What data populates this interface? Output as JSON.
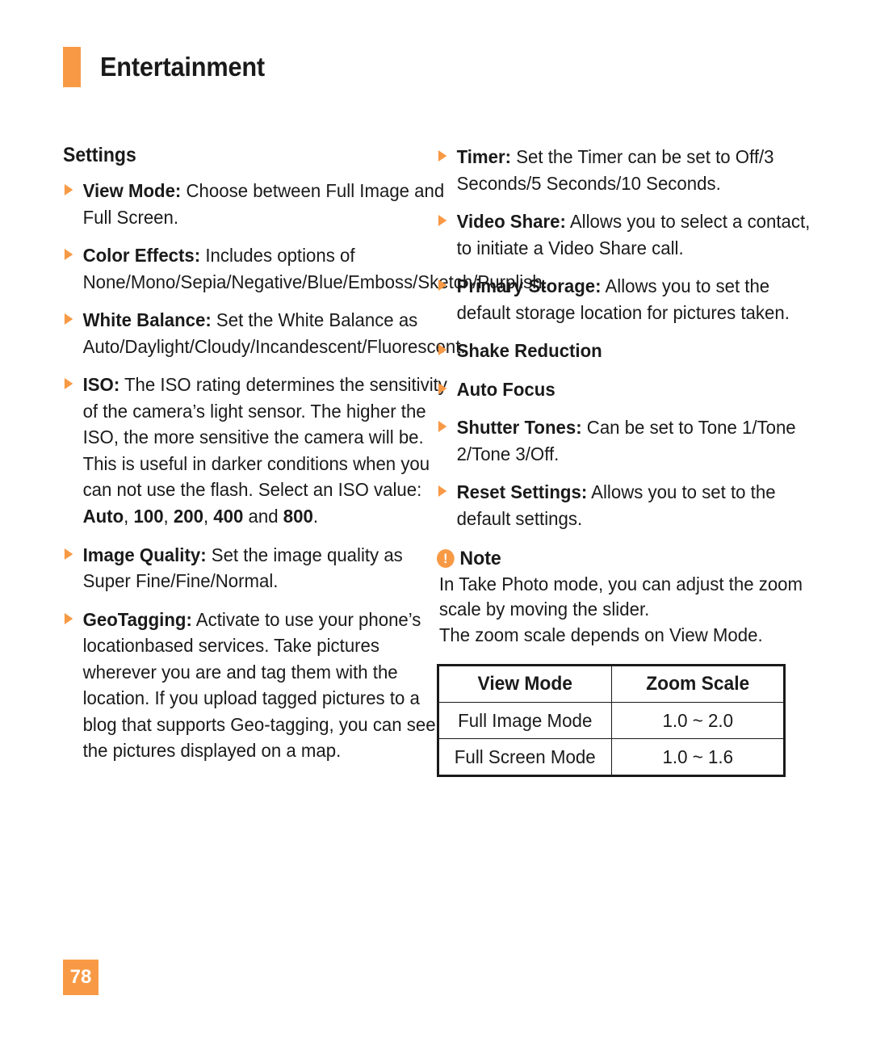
{
  "header": {
    "title": "Entertainment",
    "accent_color": "#F89A45"
  },
  "left_column": {
    "heading": "Settings",
    "items": [
      {
        "label": "View Mode:",
        "text": " Choose between Full Image and Full Screen."
      },
      {
        "label": "Color Effects:",
        "text": " Includes options of None/Mono/Sepia/Negative/Blue/Emboss/Sketch/Purplish."
      },
      {
        "label": "White Balance:",
        "text": " Set the White Balance as Auto/Daylight/Cloudy/Incandescent/Fluorescent."
      },
      {
        "label": "ISO:",
        "text_before": " The ISO rating determines the sensitivity of the camera’s light sensor. The higher the ISO, the more sensitive the camera will be. This is useful in darker conditions when you can not use the flash. Select an ISO value: ",
        "value_1": "Auto",
        "sep_1": ", ",
        "value_2": "100",
        "sep_2": ", ",
        "value_3": "200",
        "sep_3": ", ",
        "value_4": "400",
        "sep_4": " and ",
        "value_5": "800",
        "text_after": "."
      },
      {
        "label": "Image Quality:",
        "text": " Set the image quality as Super Fine/Fine/Normal."
      },
      {
        "label": "GeoTagging:",
        "text": " Activate to use your phone’s locationbased services. Take pictures wherever you are and tag them with the location. If you upload tagged pictures to a blog that supports Geo-tagging, you can see the pictures displayed on a map."
      }
    ]
  },
  "right_column": {
    "items": [
      {
        "label": "Timer:",
        "text": " Set the Timer can be set to Off/3 Seconds/5 Seconds/10 Seconds."
      },
      {
        "label": "Video Share:",
        "text": " Allows you to select a contact, to initiate a Video Share call."
      },
      {
        "label": "Primary Storage:",
        "text": " Allows you to set the default storage location for pictures taken."
      },
      {
        "label": "Shake Reduction",
        "text": ""
      },
      {
        "label": "Auto Focus",
        "text": ""
      },
      {
        "label": "Shutter Tones:",
        "text": " Can be set to Tone 1/Tone 2/Tone 3/Off."
      },
      {
        "label": "Reset Settings:",
        "text": " Allows you to set to the default settings."
      }
    ],
    "note": {
      "icon": "exclamation-circle-icon",
      "icon_glyph": "!",
      "title": "Note",
      "line_1": "In Take Photo mode, you can adjust the zoom scale by moving the slider.",
      "line_2": "The zoom scale depends on View Mode."
    },
    "table": {
      "headers": [
        "View Mode",
        "Zoom Scale"
      ],
      "rows": [
        [
          "Full Image Mode",
          "1.0 ~ 2.0"
        ],
        [
          "Full Screen Mode",
          "1.0 ~ 1.6"
        ]
      ]
    }
  },
  "footer": {
    "page_number": "78"
  }
}
